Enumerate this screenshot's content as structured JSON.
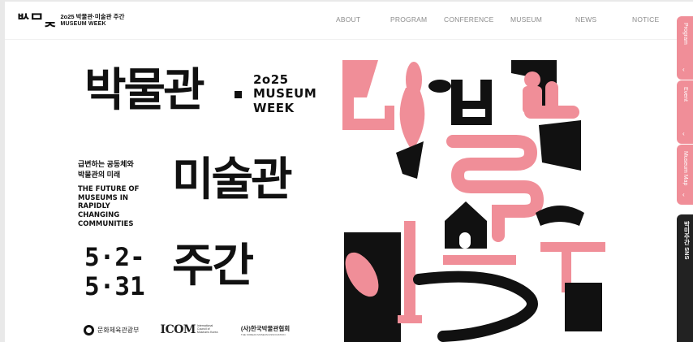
{
  "header": {
    "logo_mark": "ᄡᄆᆽ",
    "logo_line1": "2o25 박물관·미술관 주간",
    "logo_line2": "MUSEUM WEEK"
  },
  "nav": {
    "items": [
      "ABOUT",
      "PROGRAM",
      "CONFERENCE",
      "MUSEUM",
      "NEWS",
      "NOTICE"
    ]
  },
  "poster": {
    "title_line1": "박물관",
    "title_line2": "미술관",
    "title_line3": "주간",
    "year": "2o25",
    "en_title_1": "MUSEUM",
    "en_title_2": "WEEK",
    "subtitle_ko_1": "급변하는 공동체와",
    "subtitle_ko_2": "박물관의 미래",
    "subtitle_en": "THE FUTURE OF\nMUSEUMS IN\nRAPIDLY\nCHANGING\nCOMMUNITIES",
    "dates": "5·2-\n5·31"
  },
  "footer_logos": {
    "mcst": "문화체육관광부",
    "icom": "ICOM",
    "icom_sub": "International Council of Museums Korea",
    "kma": "(사)한국박물관협회",
    "kma_sub": "THE KOREAN MUSEUM ASSOCIATION"
  },
  "side_tabs": {
    "program": "Program",
    "event": "Event",
    "museum_map": "Museum Map",
    "sns": "박미주간 SNS"
  },
  "colors": {
    "accent_pink": "#f08e98",
    "ink": "#111111",
    "nav_gray": "#8c8c8c"
  }
}
